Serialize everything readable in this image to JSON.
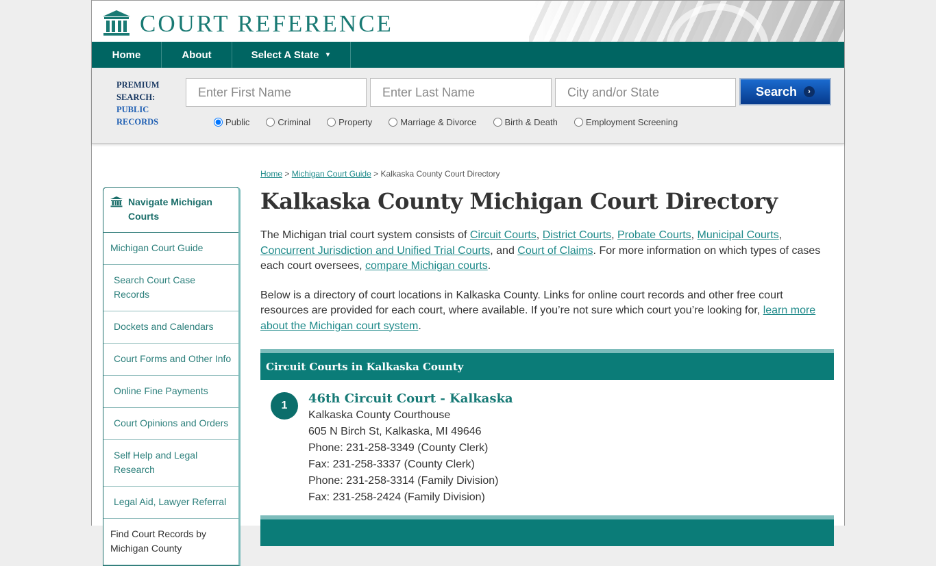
{
  "brand": {
    "name": "COURT REFERENCE",
    "accent": "#006562",
    "link_color": "#1f8a8a"
  },
  "nav": {
    "home": "Home",
    "about": "About",
    "select_state": "Select A State",
    "caret": "▼"
  },
  "search": {
    "premium_line1": "PREMIUM",
    "premium_line2": "SEARCH:",
    "premium_line3": "PUBLIC",
    "premium_line4": "RECORDS",
    "first_name_placeholder": "Enter First Name",
    "last_name_placeholder": "Enter Last Name",
    "city_placeholder": "City and/or State",
    "button_label": "Search",
    "button_icon": "›",
    "record_types": [
      {
        "label": "Public",
        "checked": true
      },
      {
        "label": "Criminal",
        "checked": false
      },
      {
        "label": "Property",
        "checked": false
      },
      {
        "label": "Marriage & Divorce",
        "checked": false
      },
      {
        "label": "Birth & Death",
        "checked": false
      },
      {
        "label": "Employment Screening",
        "checked": false
      }
    ]
  },
  "sidebar": {
    "title": "Navigate Michigan Courts",
    "items": [
      {
        "label": "Michigan Court Guide"
      },
      {
        "label": "Search Court Case Records"
      },
      {
        "label": "Dockets and Calendars"
      },
      {
        "label": "Court Forms and Other Info"
      },
      {
        "label": "Online Fine Payments"
      },
      {
        "label": "Court Opinions and Orders"
      },
      {
        "label": "Self Help and Legal Research"
      },
      {
        "label": "Legal Aid, Lawyer Referral"
      },
      {
        "label": "Find Court Records by Michigan County"
      }
    ]
  },
  "breadcrumb": {
    "home": "Home",
    "sep": " > ",
    "guide": "Michigan Court Guide",
    "current": "Kalkaska County Court Directory"
  },
  "page_title": "Kalkaska County Michigan Court Directory",
  "intro": {
    "t1": "The Michigan trial court system consists of ",
    "l1": "Circuit Courts",
    "t2": ", ",
    "l2": "District Courts",
    "t3": ", ",
    "l3": "Probate Courts",
    "t4": ", ",
    "l4": "Municipal Courts",
    "t5": ", ",
    "l5": "Concurrent Jurisdiction and Unified Trial Courts",
    "t6": ", and ",
    "l6": "Court of Claims",
    "t7": ". For more information on which types of cases each court oversees, ",
    "l7": "compare Michigan courts",
    "t8": "."
  },
  "directory_intro": {
    "t1": "Below is a directory of court locations in Kalkaska County. Links for online court records and other free court resources are provided for each court, where available. If you’re not sure which court you’re looking for, ",
    "l1": "learn more about the Michigan court system",
    "t2": "."
  },
  "sections": [
    {
      "title": "Circuit Courts in Kalkaska County",
      "courts": [
        {
          "number": "1",
          "name": "46th Circuit Court - Kalkaska",
          "lines": [
            "Kalkaska County Courthouse",
            "605 N Birch St, Kalkaska, MI 49646",
            "Phone: 231-258-3349 (County Clerk)",
            "Fax: 231-258-3337 (County Clerk)",
            "Phone: 231-258-3314 (Family Division)",
            "Fax: 231-258-2424 (Family Division)"
          ]
        }
      ]
    }
  ]
}
